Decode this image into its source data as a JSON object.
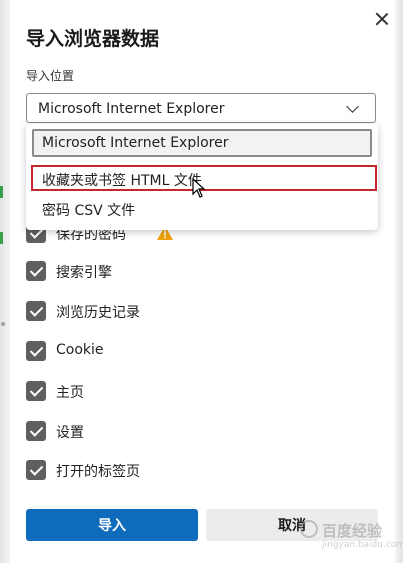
{
  "dialog": {
    "title": "导入浏览器数据",
    "field_label": "导入位置",
    "selected_source": "Microsoft Internet Explorer"
  },
  "dropdown": {
    "options": [
      "Microsoft Internet Explorer",
      "收藏夹或书签 HTML 文件",
      "密码 CSV 文件"
    ]
  },
  "items": [
    {
      "label": "保存的密码",
      "checked": true,
      "warning": true
    },
    {
      "label": "搜索引擎",
      "checked": true
    },
    {
      "label": "浏览历史记录",
      "checked": true
    },
    {
      "label": "Cookie",
      "checked": true
    },
    {
      "label": "主页",
      "checked": true
    },
    {
      "label": "设置",
      "checked": true
    },
    {
      "label": "打开的标签页",
      "checked": true
    }
  ],
  "buttons": {
    "import": "导入",
    "cancel": "取消"
  },
  "watermark": {
    "text": "百度经验",
    "sub": "jingyan.baidu.com"
  },
  "colors": {
    "primary": "#0f6cbd",
    "checkbox": "#5f5f5f",
    "hover_outline": "#c4282e",
    "warning": "#f0a30a"
  }
}
